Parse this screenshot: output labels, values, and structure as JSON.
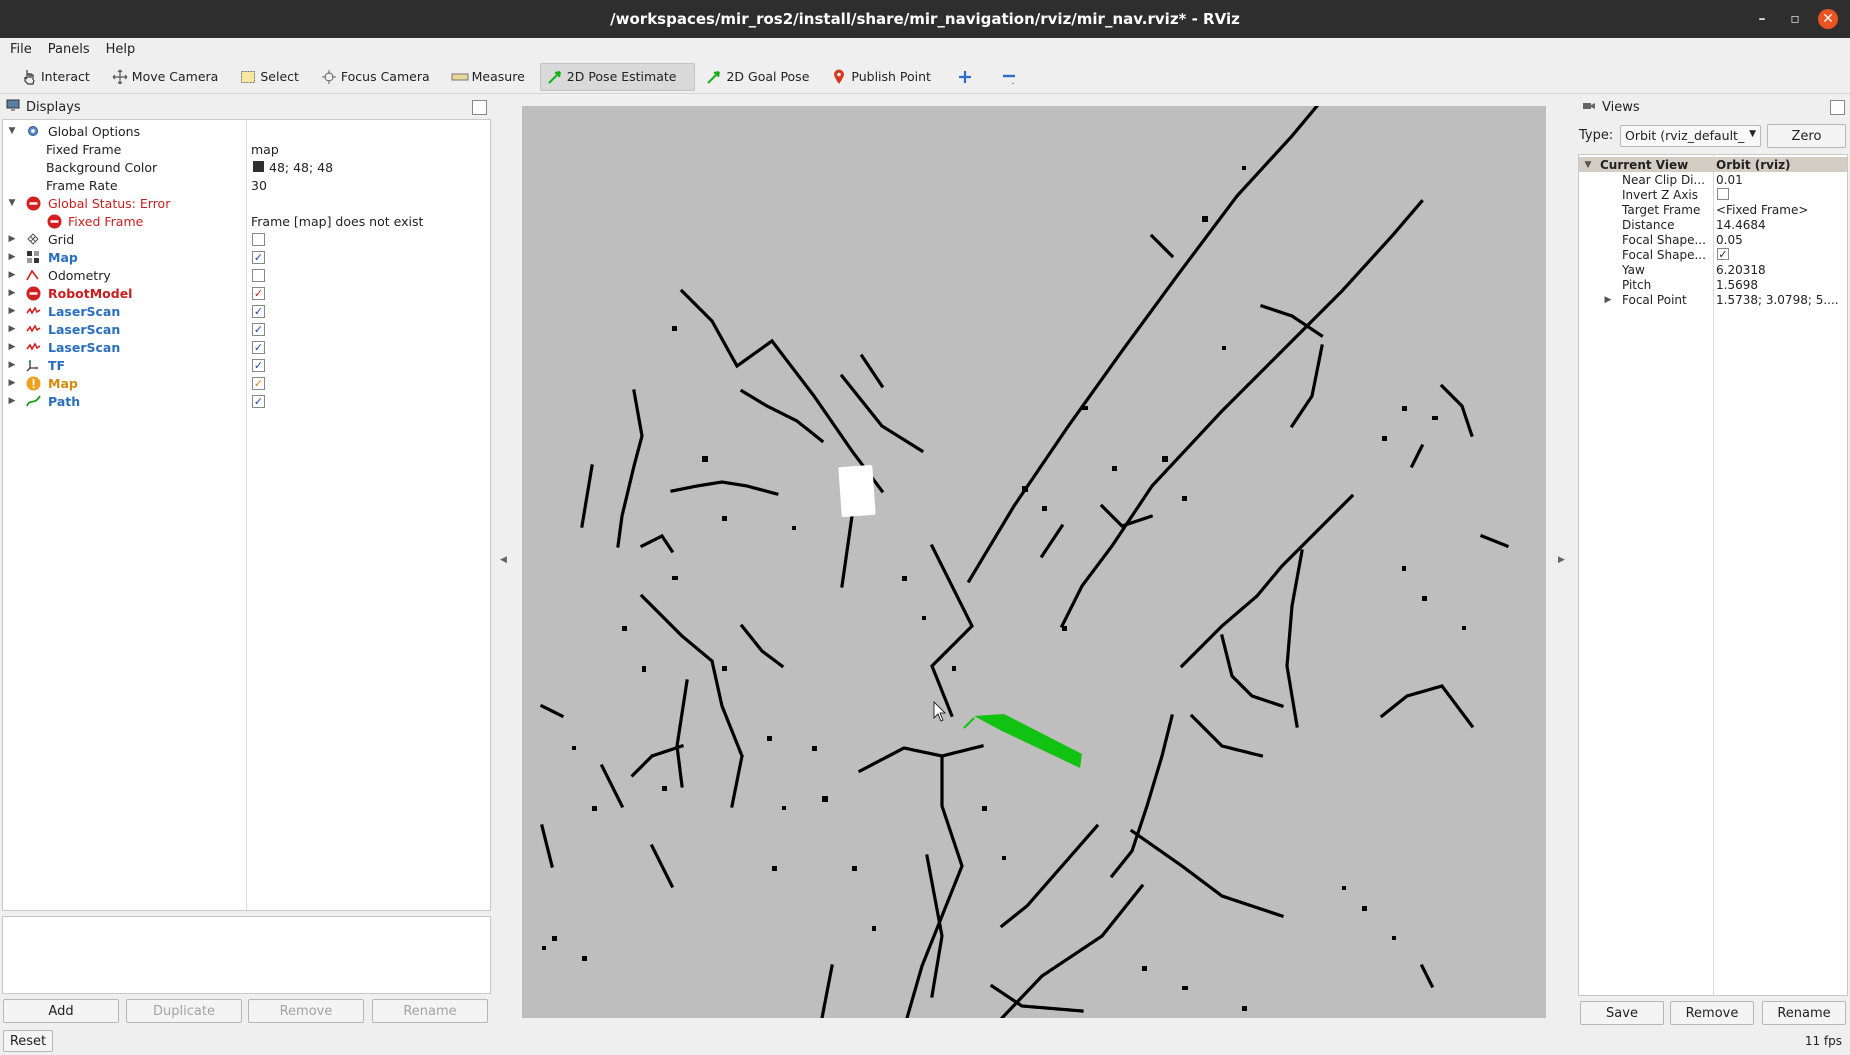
{
  "window": {
    "title": "/workspaces/mir_ros2/install/share/mir_navigation/rviz/mir_nav.rviz* - RViz",
    "controls": [
      "–",
      "▫",
      "✕"
    ]
  },
  "menubar": {
    "items": [
      "File",
      "Panels",
      "Help"
    ]
  },
  "toolbar": {
    "tools": [
      {
        "label": "Interact",
        "icon": "hand-cursor-icon"
      },
      {
        "label": "Move Camera",
        "icon": "move-camera-icon"
      },
      {
        "label": "Select",
        "icon": "select-box-icon"
      },
      {
        "label": "Focus Camera",
        "icon": "focus-camera-icon"
      },
      {
        "label": "Measure",
        "icon": "ruler-icon"
      },
      {
        "label": "2D Pose Estimate",
        "icon": "green-arrow-icon",
        "active": true
      },
      {
        "label": "2D Goal Pose",
        "icon": "green-arrow-icon"
      },
      {
        "label": "Publish Point",
        "icon": "map-pin-icon"
      }
    ],
    "add_icon": "plus-icon",
    "remove_icon": "minus-icon"
  },
  "displays": {
    "title": "Displays",
    "global_options": {
      "label": "Global Options",
      "fixed_frame_label": "Fixed Frame",
      "fixed_frame_value": "map",
      "background_color_label": "Background Color",
      "background_color_value": "48; 48; 48",
      "background_color_swatch": "#303030",
      "frame_rate_label": "Frame Rate",
      "frame_rate_value": "30"
    },
    "global_status": {
      "label": "Global Status: Error",
      "child_label": "Fixed Frame",
      "child_value": "Frame [map] does not exist"
    },
    "items": [
      {
        "label": "Grid",
        "checked": false,
        "style": "normal",
        "icon": "grid-icon"
      },
      {
        "label": "Map",
        "checked": true,
        "style": "blue",
        "icon": "map-icon"
      },
      {
        "label": "Odometry",
        "checked": false,
        "style": "normal",
        "icon": "odometry-icon"
      },
      {
        "label": "RobotModel",
        "checked": true,
        "style": "red",
        "icon": "error-icon"
      },
      {
        "label": "LaserScan",
        "checked": true,
        "style": "blue",
        "icon": "laserscan-icon"
      },
      {
        "label": "LaserScan",
        "checked": true,
        "style": "blue",
        "icon": "laserscan-icon"
      },
      {
        "label": "LaserScan",
        "checked": true,
        "style": "blue",
        "icon": "laserscan-icon"
      },
      {
        "label": "TF",
        "checked": true,
        "style": "blue",
        "icon": "tf-icon"
      },
      {
        "label": "Map",
        "checked": true,
        "style": "orange",
        "icon": "warning-icon"
      },
      {
        "label": "Path",
        "checked": true,
        "style": "blue",
        "icon": "path-icon"
      }
    ],
    "buttons": {
      "add": "Add",
      "duplicate": "Duplicate",
      "remove": "Remove",
      "rename": "Rename"
    }
  },
  "footer": {
    "reset": "Reset",
    "fps": "11 fps"
  },
  "views": {
    "title": "Views",
    "type_label": "Type:",
    "type_value": "Orbit (rviz_default_",
    "zero_button": "Zero",
    "current_view_label": "Current View",
    "current_view_value": "Orbit (rviz)",
    "properties": [
      {
        "label": "Near Clip Di...",
        "value": "0.01"
      },
      {
        "label": "Invert Z Axis",
        "checkbox": false
      },
      {
        "label": "Target Frame",
        "value": "<Fixed Frame>"
      },
      {
        "label": "Distance",
        "value": "14.4684"
      },
      {
        "label": "Focal Shape...",
        "value": "0.05"
      },
      {
        "label": "Focal Shape...",
        "checkbox": true
      },
      {
        "label": "Yaw",
        "value": "6.20318"
      },
      {
        "label": "Pitch",
        "value": "1.5698"
      },
      {
        "label": "Focal Point",
        "value": "1.5738; 3.0798; 5....",
        "expandable": true
      }
    ],
    "buttons": {
      "save": "Save",
      "remove": "Remove",
      "rename": "Rename"
    }
  },
  "viewport": {
    "background": "#bebebe",
    "obstacle_color": "#000000",
    "pose_arrow_color": "#13c513"
  }
}
